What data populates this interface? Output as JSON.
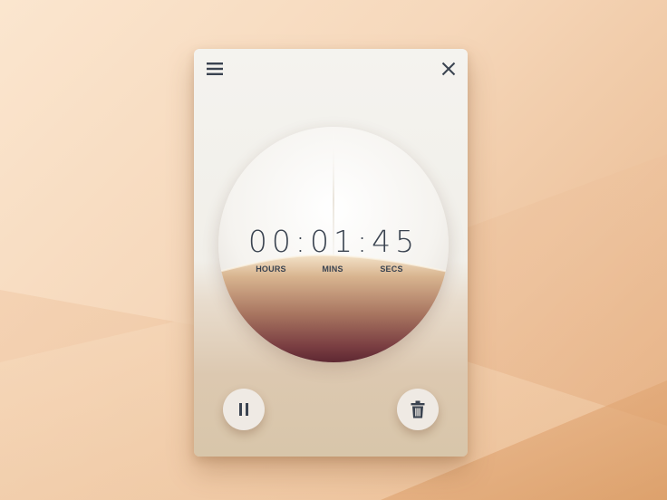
{
  "timer": {
    "display": "00:01:45",
    "hours_label": "HOURS",
    "mins_label": "MINS",
    "secs_label": "SECS"
  },
  "header": {
    "menu_icon": "hamburger-menu-icon",
    "close_icon": "close-icon"
  },
  "controls": {
    "pause_icon": "pause-icon",
    "delete_icon": "trash-icon"
  },
  "colors": {
    "text": "#3a4350",
    "sand_top": "#f0dcc2",
    "sand_bottom": "#5e2832",
    "card_bg": "#f4f3ef"
  }
}
